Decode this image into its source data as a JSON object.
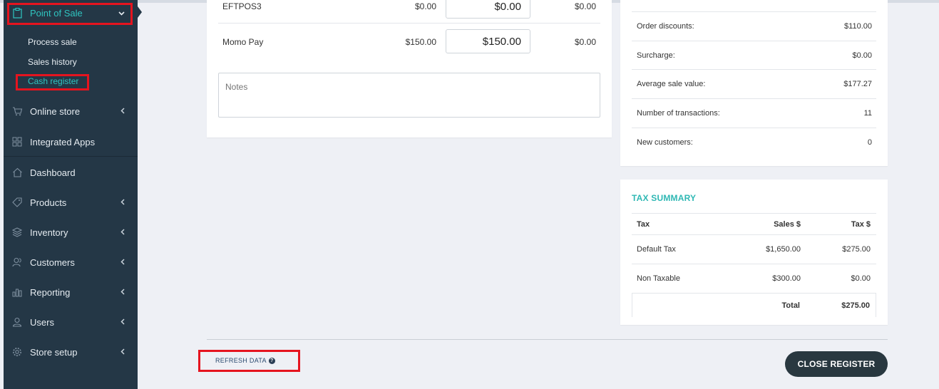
{
  "sidebar": {
    "point_of_sale": {
      "label": "Point of Sale",
      "icon": "clipboard-icon"
    },
    "sub_items": [
      {
        "label": "Process sale"
      },
      {
        "label": "Sales history"
      },
      {
        "label": "Cash register"
      }
    ],
    "items": [
      {
        "label": "Online store",
        "icon": "cart-icon"
      },
      {
        "label": "Integrated Apps",
        "icon": "grid-icon"
      },
      {
        "label": "Dashboard",
        "icon": "home-icon"
      },
      {
        "label": "Products",
        "icon": "tag-icon"
      },
      {
        "label": "Inventory",
        "icon": "layers-icon"
      },
      {
        "label": "Customers",
        "icon": "users-icon"
      },
      {
        "label": "Reporting",
        "icon": "bar-chart-icon"
      },
      {
        "label": "Users",
        "icon": "user-icon"
      },
      {
        "label": "Store setup",
        "icon": "gear-icon"
      }
    ]
  },
  "payments": [
    {
      "name": "EFTPOS3",
      "expected": "$0.00",
      "counted": "$0.00",
      "difference": "$0.00"
    },
    {
      "name": "Momo Pay",
      "expected": "$150.00",
      "counted": "$150.00",
      "difference": "$0.00"
    }
  ],
  "notes": {
    "placeholder": "Notes"
  },
  "summary": [
    {
      "label": "Order discounts:",
      "value": "$110.00"
    },
    {
      "label": "Surcharge:",
      "value": "$0.00"
    },
    {
      "label": "Average sale value:",
      "value": "$177.27"
    },
    {
      "label": "Number of transactions:",
      "value": "11"
    },
    {
      "label": "New customers:",
      "value": "0"
    }
  ],
  "tax_summary": {
    "title": "TAX SUMMARY",
    "headers": [
      "Tax",
      "Sales $",
      "Tax $"
    ],
    "rows": [
      {
        "tax": "Default Tax",
        "sales": "$1,650.00",
        "tax_amount": "$275.00"
      },
      {
        "tax": "Non Taxable",
        "sales": "$300.00",
        "tax_amount": "$0.00"
      }
    ],
    "total": {
      "label": "Total",
      "value": "$275.00"
    }
  },
  "footer": {
    "refresh_label": "REFRESH DATA",
    "close_label": "CLOSE REGISTER"
  },
  "colors": {
    "sidebar": "#243746",
    "accent": "#2fc4c0",
    "highlight": "#e5141f",
    "close_button": "#293840"
  }
}
